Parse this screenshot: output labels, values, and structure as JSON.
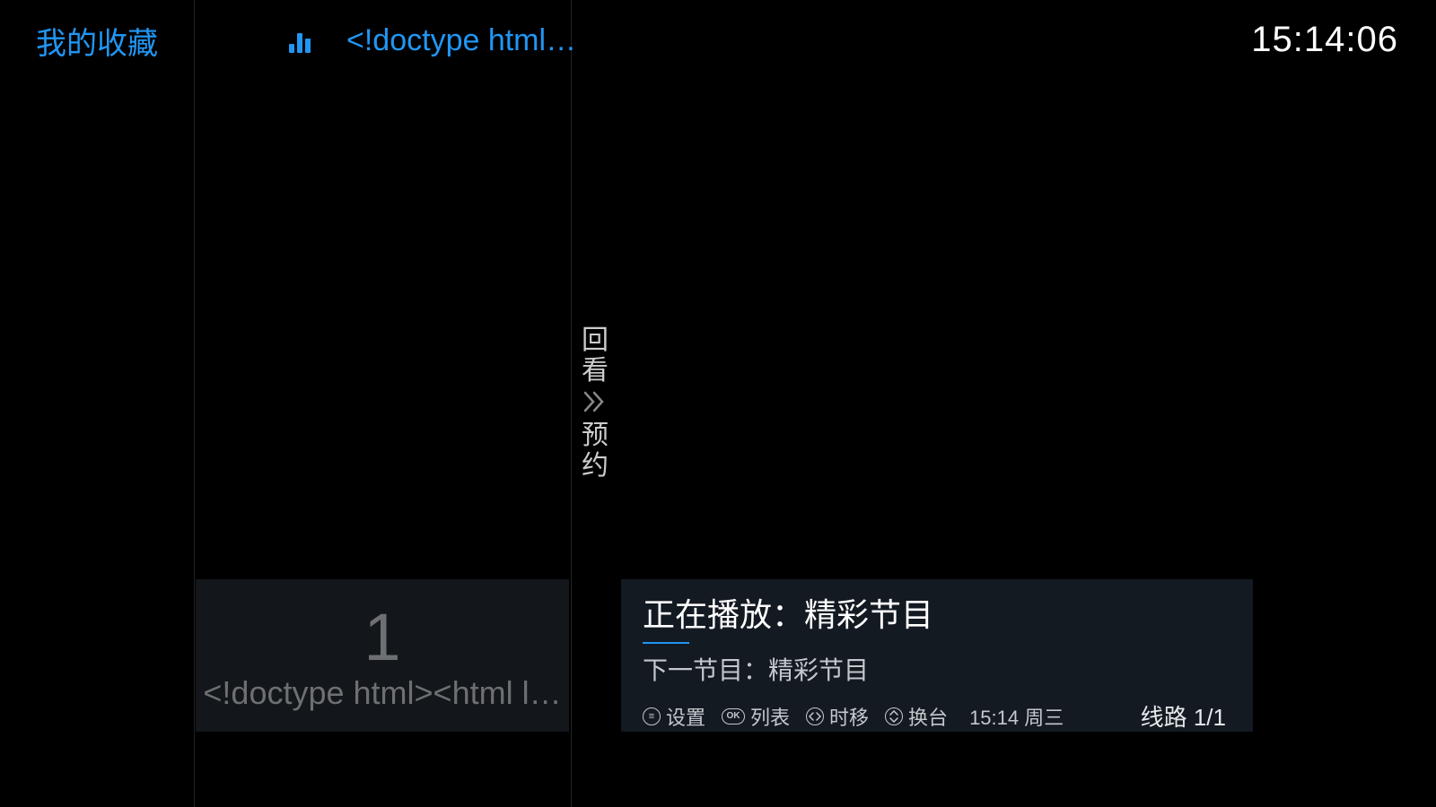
{
  "header": {
    "favorites_label": "我的收藏",
    "current_channel_title": "<!doctype html…",
    "clock": "15:14:06"
  },
  "side_action": {
    "replay_label": "回看",
    "reserve_label": "预约"
  },
  "channel_preview": {
    "number": "1",
    "name": "<!doctype html><html l…"
  },
  "info_panel": {
    "now_playing_prefix": "正在播放：",
    "now_playing_title": "精彩节目",
    "next_prefix": "下一节目：",
    "next_title": "精彩节目",
    "progress_percent": 8,
    "controls": {
      "settings": "设置",
      "list": "列表",
      "timeshift": "时移",
      "switch": "换台"
    },
    "datetime_short": "15:14 周三",
    "line_label": "线路 1/1"
  }
}
